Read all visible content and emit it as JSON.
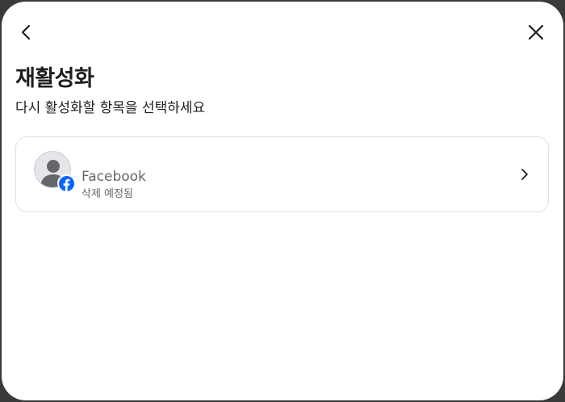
{
  "dialog": {
    "title": "재활성화",
    "subtitle": "다시 활성화할 항목을 선택하세요",
    "back_icon": "chevron-left-icon",
    "close_icon": "close-icon"
  },
  "accounts": [
    {
      "name": "Facebook",
      "status": "삭제 예정됨",
      "avatar_icon": "default-avatar-icon",
      "badge_icon": "facebook-logo-icon",
      "action_icon": "chevron-right-icon"
    }
  ],
  "colors": {
    "facebook_blue": "#0866ff",
    "text_primary": "#1c1e21",
    "text_secondary": "#65676b",
    "card_border": "#dddfe2"
  }
}
